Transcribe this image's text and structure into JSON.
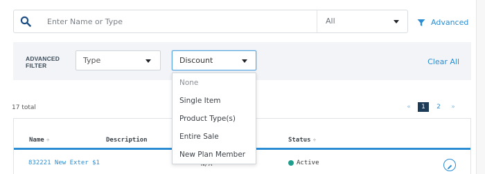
{
  "search": {
    "placeholder": "Enter Name or Type",
    "scope_value": "All",
    "advanced_label": "Advanced"
  },
  "advanced_filter": {
    "title_line1": "ADVANCED",
    "title_line2": "FILTER",
    "type_select": "Type",
    "discount_select": "Discount",
    "clear_all": "Clear All",
    "discount_options": [
      "None",
      "Single Item",
      "Product Type(s)",
      "Entire Sale",
      "New Plan Member"
    ]
  },
  "results": {
    "total_text": "17 total",
    "pagination": {
      "prev": "«",
      "pages": [
        "1",
        "2"
      ],
      "current_page": "1",
      "next": "»"
    }
  },
  "table": {
    "columns": {
      "name": "Name",
      "description": "Description",
      "status": "Status"
    },
    "sort_glyph": "÷",
    "rows": [
      {
        "name": "832221 New Exter $1",
        "description": "N/A",
        "status": "Active",
        "status_color": "#1e9e8c"
      }
    ]
  },
  "colors": {
    "accent": "#2a8cd3",
    "panel_bg": "#f2f4f7",
    "active_page_bg": "#1d3a57",
    "status_active": "#1e9e8c"
  },
  "icons": {
    "search": "search-icon",
    "filter": "filter-icon",
    "caret": "chevron-down-icon",
    "edit": "pencil-icon"
  }
}
